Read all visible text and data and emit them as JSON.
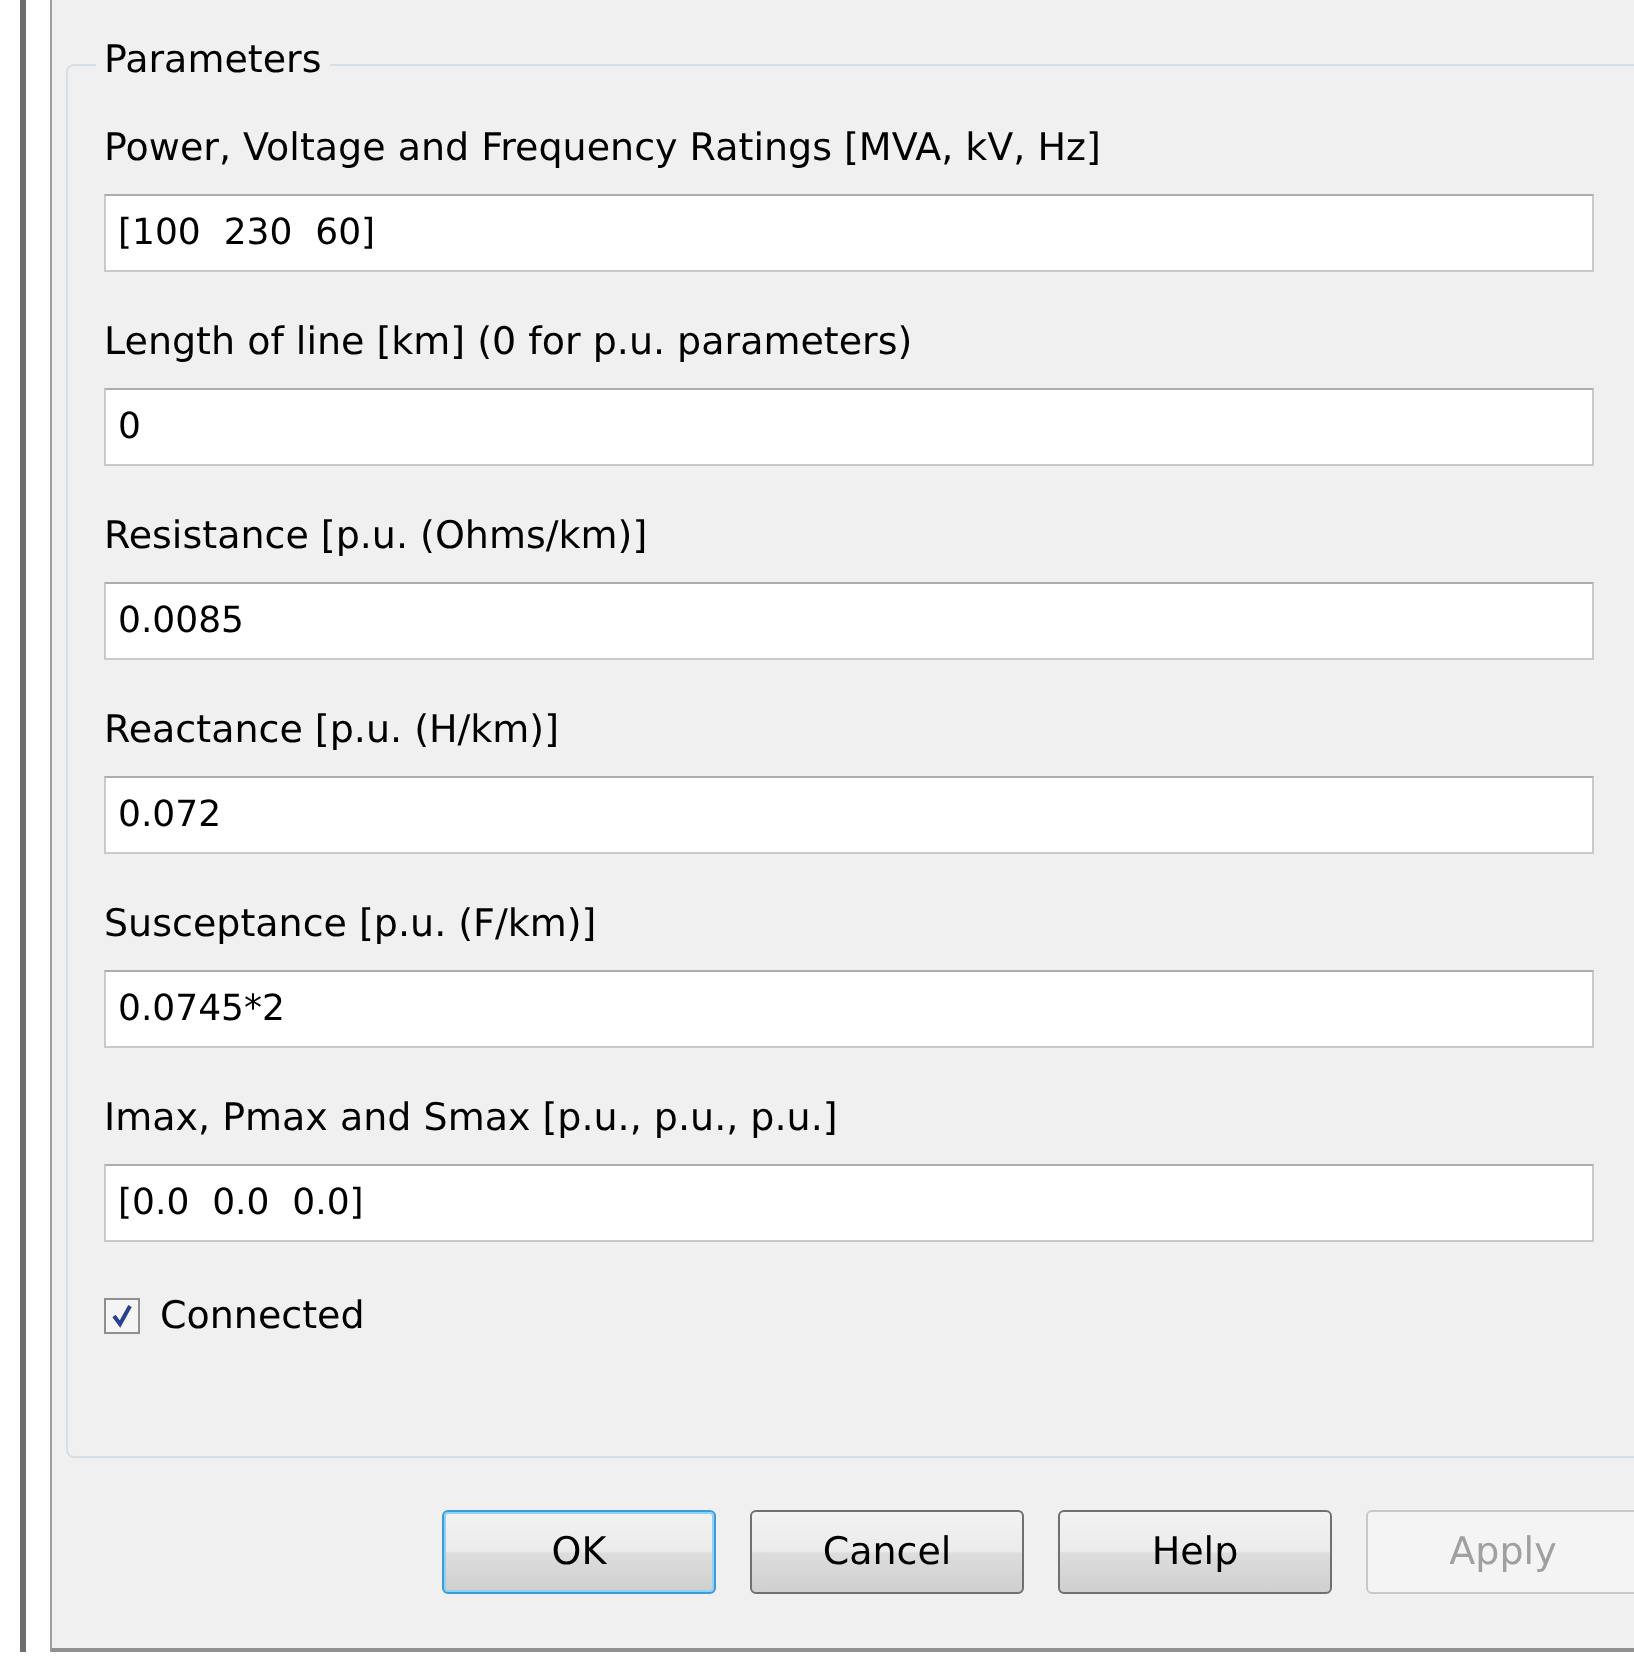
{
  "group": {
    "title": "Parameters"
  },
  "fields": [
    {
      "label": "Power, Voltage and Frequency Ratings [MVA, kV, Hz]",
      "value": "[100  230  60]"
    },
    {
      "label": "Length of line [km] (0 for p.u. parameters)",
      "value": "0"
    },
    {
      "label": "Resistance [p.u. (Ohms/km)]",
      "value": "0.0085"
    },
    {
      "label": "Reactance [p.u. (H/km)]",
      "value": "0.072"
    },
    {
      "label": "Susceptance [p.u. (F/km)]",
      "value": "0.0745*2"
    },
    {
      "label": "Imax, Pmax and Smax [p.u., p.u., p.u.]",
      "value": "[0.0  0.0  0.0]"
    }
  ],
  "checkbox": {
    "label": "Connected",
    "checked": true
  },
  "buttons": [
    {
      "label": "OK",
      "default": true,
      "disabled": false
    },
    {
      "label": "Cancel",
      "default": false,
      "disabled": false
    },
    {
      "label": "Help",
      "default": false,
      "disabled": false
    },
    {
      "label": "Apply",
      "default": false,
      "disabled": true
    }
  ]
}
